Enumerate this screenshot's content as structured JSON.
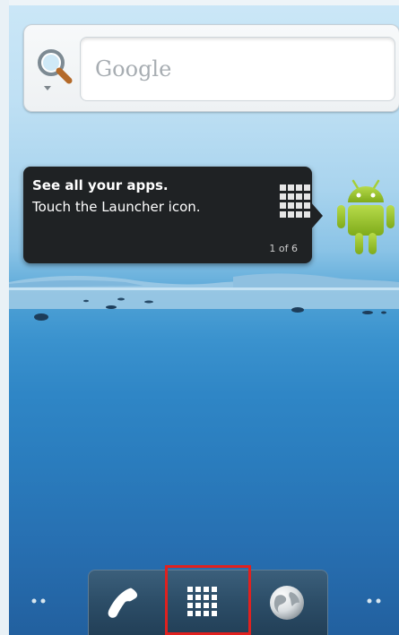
{
  "search_widget": {
    "placeholder": "Google",
    "icon": "magnifier-icon"
  },
  "tooltip": {
    "title": "See all your apps.",
    "text": "Touch the Launcher icon.",
    "page": "1 of 6",
    "icon": "launcher-grid-icon"
  },
  "android_icon": "android-robot-icon",
  "dock": {
    "phone_icon": "phone-icon",
    "launcher_icon": "launcher-grid-icon",
    "browser_icon": "browser-globe-icon",
    "highlight_color": "#e0211f"
  },
  "colors": {
    "sky_top": "#cbe7f7",
    "water_bottom": "#22609f",
    "tooltip_bg": "#1f2224",
    "android_green": "#97c024"
  }
}
